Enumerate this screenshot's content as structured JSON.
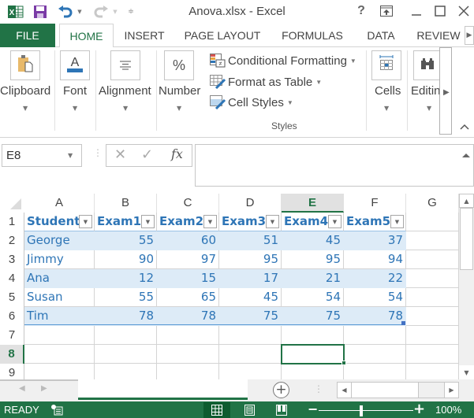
{
  "window": {
    "title": "Anova.xlsx - Excel",
    "help_label": "?",
    "minimize_label": "—",
    "maximize_label": "☐",
    "close_label": "✕"
  },
  "quick_access": {
    "icons": [
      "excel-logo-icon",
      "save-icon",
      "undo-icon",
      "redo-icon",
      "customize-qat-icon"
    ]
  },
  "tabs": [
    {
      "label": "FILE"
    },
    {
      "label": "HOME",
      "active": true
    },
    {
      "label": "INSERT"
    },
    {
      "label": "PAGE LAYOUT"
    },
    {
      "label": "FORMULAS"
    },
    {
      "label": "DATA"
    },
    {
      "label": "REVIEW"
    }
  ],
  "ribbon": {
    "groups": [
      {
        "label": "Clipboard",
        "icon": "clipboard-icon"
      },
      {
        "label": "Font",
        "icon": "font-color-icon"
      },
      {
        "label": "Alignment",
        "icon": "align-center-icon"
      },
      {
        "label": "Number",
        "icon": "percent-icon"
      },
      {
        "label": "Cells",
        "icon": "cells-icon"
      },
      {
        "label": "Editin",
        "icon": "binoculars-icon"
      }
    ],
    "styles": {
      "items": [
        {
          "label": "Conditional Formatting",
          "icon": "conditional-formatting-icon"
        },
        {
          "label": "Format as Table",
          "icon": "format-as-table-icon"
        },
        {
          "label": "Cell Styles",
          "icon": "cell-styles-icon"
        }
      ],
      "group_label": "Styles"
    },
    "percent_glyph": "%",
    "font_glyph": "A"
  },
  "formula_bar": {
    "name_box": "E8",
    "cancel_glyph": "✕",
    "enter_glyph": "✓",
    "fx_label": "fx",
    "formula": ""
  },
  "sheet": {
    "columns": [
      "A",
      "B",
      "C",
      "D",
      "E",
      "F",
      "G"
    ],
    "selected_column": "E",
    "rows": [
      "1",
      "2",
      "3",
      "4",
      "5",
      "6",
      "7",
      "8",
      "9"
    ],
    "selected_row": "8",
    "selected_cell": "E8",
    "table": {
      "headers": [
        "Student",
        "Exam1",
        "Exam2",
        "Exam3",
        "Exam4",
        "Exam5"
      ],
      "data": [
        [
          "George",
          "55",
          "60",
          "51",
          "45",
          "37"
        ],
        [
          "Jimmy",
          "90",
          "97",
          "95",
          "95",
          "94"
        ],
        [
          "Ana",
          "12",
          "15",
          "17",
          "21",
          "22"
        ],
        [
          "Susan",
          "55",
          "65",
          "45",
          "54",
          "54"
        ],
        [
          "Tim",
          "78",
          "78",
          "75",
          "75",
          "78"
        ]
      ],
      "header_color": "#2e75b6",
      "band_color": "#ddebf7"
    }
  },
  "sheet_bar": {
    "add_sheet_label": "+"
  },
  "status_bar": {
    "status": "READY",
    "zoom": "100%",
    "zoom_level_percent": 100,
    "views": [
      "normal-view-icon",
      "page-layout-view-icon",
      "page-break-preview-icon"
    ],
    "active_view": "normal-view-icon",
    "accent_color": "#217346"
  }
}
